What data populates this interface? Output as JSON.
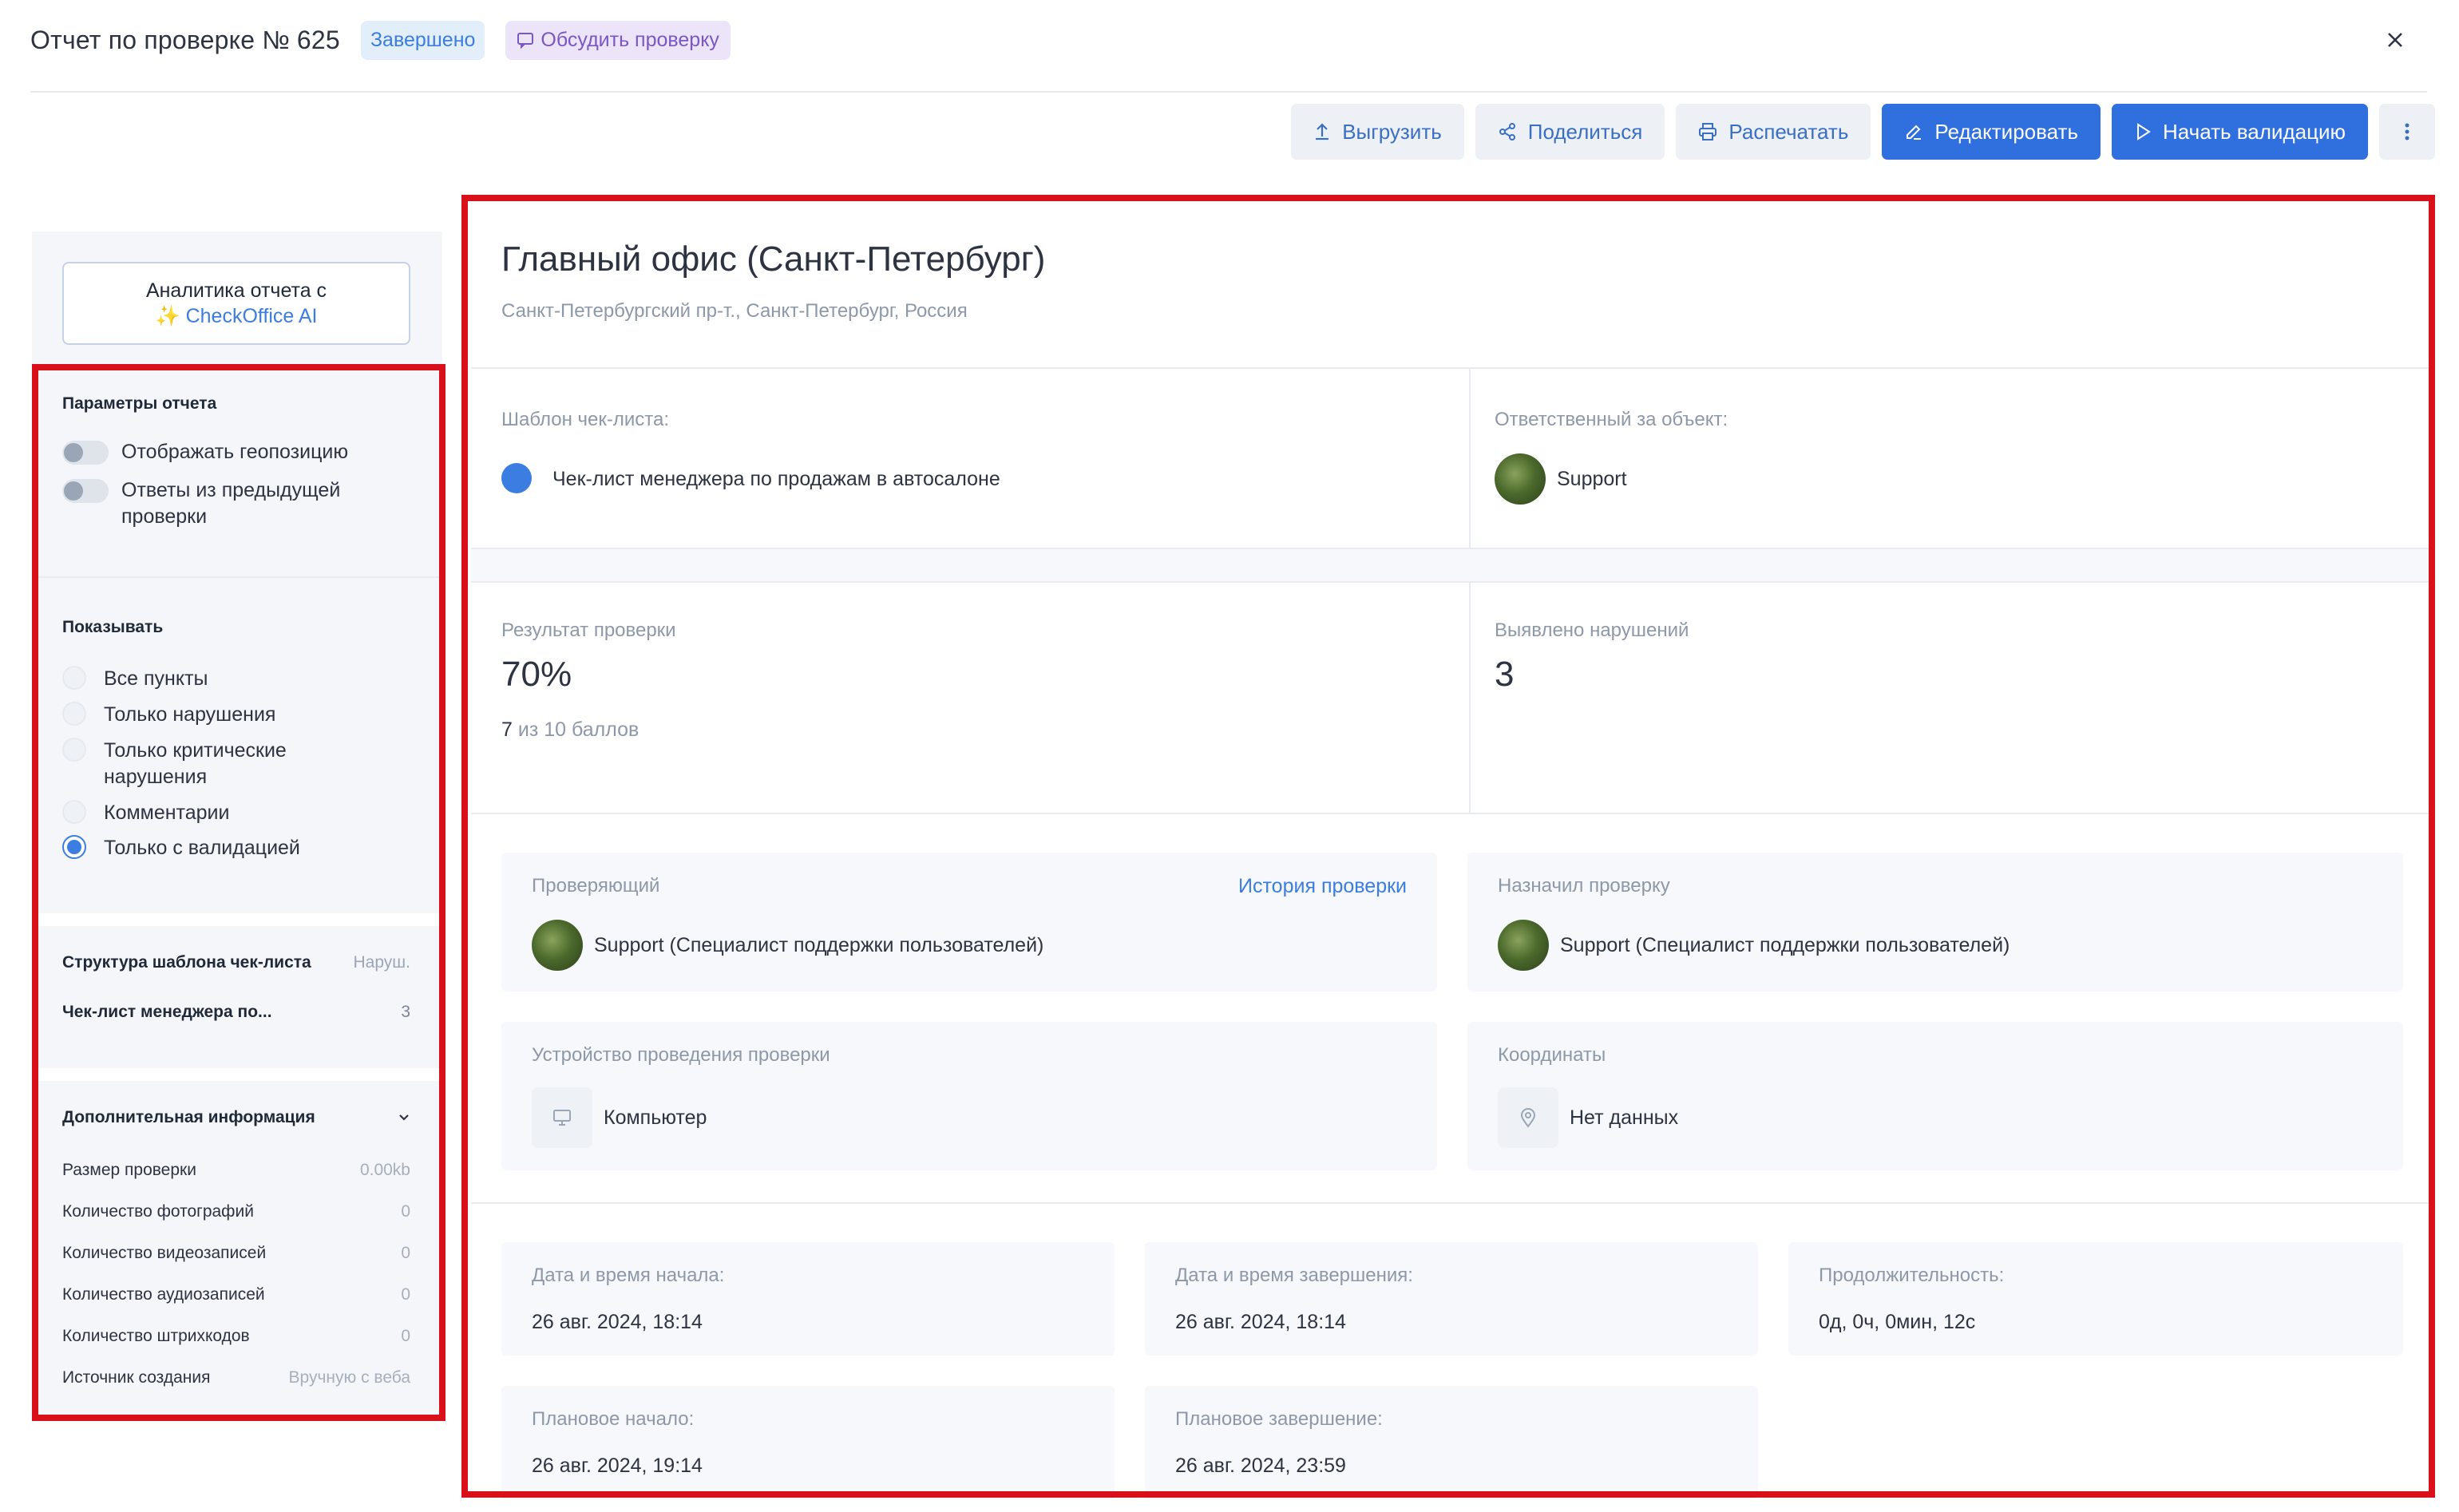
{
  "header": {
    "title": "Отчет по проверке № 625",
    "status_badge": "Завершено",
    "discuss_label": "Обсудить проверку"
  },
  "toolbar": {
    "export_label": "Выгрузить",
    "share_label": "Поделиться",
    "print_label": "Распечатать",
    "edit_label": "Редактировать",
    "validate_label": "Начать валидацию"
  },
  "sidebar": {
    "ai_button_line1": "Аналитика отчета с",
    "ai_button_sparkle": "✨",
    "ai_button_brand_a": "CheckOffice",
    "ai_button_brand_b": " AI",
    "report_params": {
      "title": "Параметры отчета",
      "toggles": [
        {
          "label": "Отображать геопозицию",
          "on": false
        },
        {
          "label": "Ответы из предыдущей проверки",
          "on": false
        }
      ]
    },
    "show": {
      "title": "Показывать",
      "options": [
        {
          "label": "Все пункты",
          "checked": false
        },
        {
          "label": "Только нарушения",
          "checked": false
        },
        {
          "label": "Только критические нарушения",
          "checked": false
        },
        {
          "label": "Комментарии",
          "checked": false
        },
        {
          "label": "Только с валидацией",
          "checked": true
        }
      ]
    },
    "structure": {
      "title": "Структура шаблона чек-листа",
      "column": "Наруш.",
      "row_label": "Чек-лист менеджера по...",
      "row_value": "3"
    },
    "extra": {
      "title": "Дополнительная информация",
      "rows": [
        {
          "key": "Размер проверки",
          "value": "0.00kb"
        },
        {
          "key": "Количество фотографий",
          "value": "0"
        },
        {
          "key": "Количество видеозаписей",
          "value": "0"
        },
        {
          "key": "Количество аудиозаписей",
          "value": "0"
        },
        {
          "key": "Количество штрихкодов",
          "value": "0"
        },
        {
          "key": "Источник создания",
          "value": "Вручную с веба"
        }
      ]
    }
  },
  "main": {
    "place_title": "Главный офис (Санкт-Петербург)",
    "place_address": "Санкт-Петербургский пр-т., Санкт-Петербург, Россия",
    "template_label": "Шаблон чек-листа:",
    "template_value": "Чек-лист менеджера по продажам в автосалоне",
    "responsible_label": "Ответственный за объект:",
    "responsible_value": "Support",
    "result_label": "Результат проверки",
    "result_value": "70%",
    "score_value": "7",
    "score_suffix": " из 10 баллов",
    "violations_label": "Выявлено нарушений",
    "violations_value": "3",
    "inspector_label": "Проверяющий",
    "inspector_history": "История проверки",
    "inspector_value": "Support (Специалист поддержки пользователей)",
    "assigned_label": "Назначил проверку",
    "assigned_value": "Support (Специалист поддержки пользователей)",
    "device_label": "Устройство проведения проверки",
    "device_value": "Компьютер",
    "coords_label": "Координаты",
    "coords_value": "Нет данных",
    "start_label": "Дата и время начала:",
    "start_value": "26 авг. 2024, 18:14",
    "end_label": "Дата и время завершения:",
    "end_value": "26 авг. 2024, 18:14",
    "duration_label": "Продолжительность:",
    "duration_value": "0д, 0ч, 0мин, 12с",
    "plan_start_label": "Плановое начало:",
    "plan_start_value": "26 авг. 2024, 19:14",
    "plan_end_label": "Плановое завершение:",
    "plan_end_value": "26 авг. 2024, 23:59"
  },
  "colors": {
    "primary": "#2f6fde",
    "highlight": "#d9101a",
    "badge_done_bg": "#e3eefb",
    "badge_discuss_bg": "#ece5f9"
  }
}
